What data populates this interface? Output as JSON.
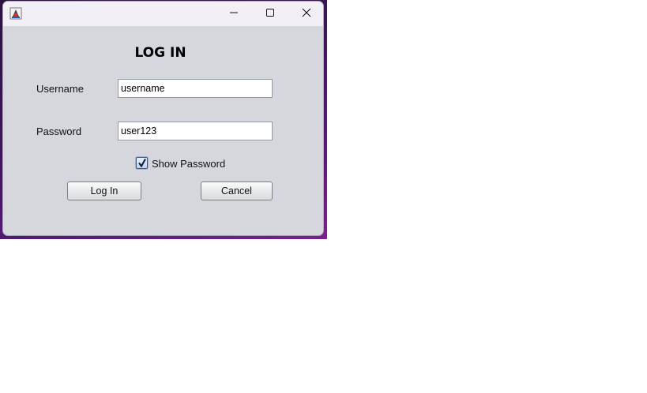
{
  "window": {
    "title": "",
    "controls": {
      "minimize_icon": "minimize-icon",
      "maximize_icon": "maximize-icon",
      "close_icon": "close-icon"
    }
  },
  "form": {
    "heading": "LOG IN",
    "username_label": "Username",
    "username_value": "username",
    "password_label": "Password",
    "password_value": "user123",
    "show_password_label": "Show Password",
    "show_password_checked": true,
    "login_button": "Log In",
    "cancel_button": "Cancel"
  },
  "colors": {
    "window_bg": "#d5d7dd",
    "titlebar_bg": "#f2eff7",
    "desktop_bg": "#3b1656"
  }
}
